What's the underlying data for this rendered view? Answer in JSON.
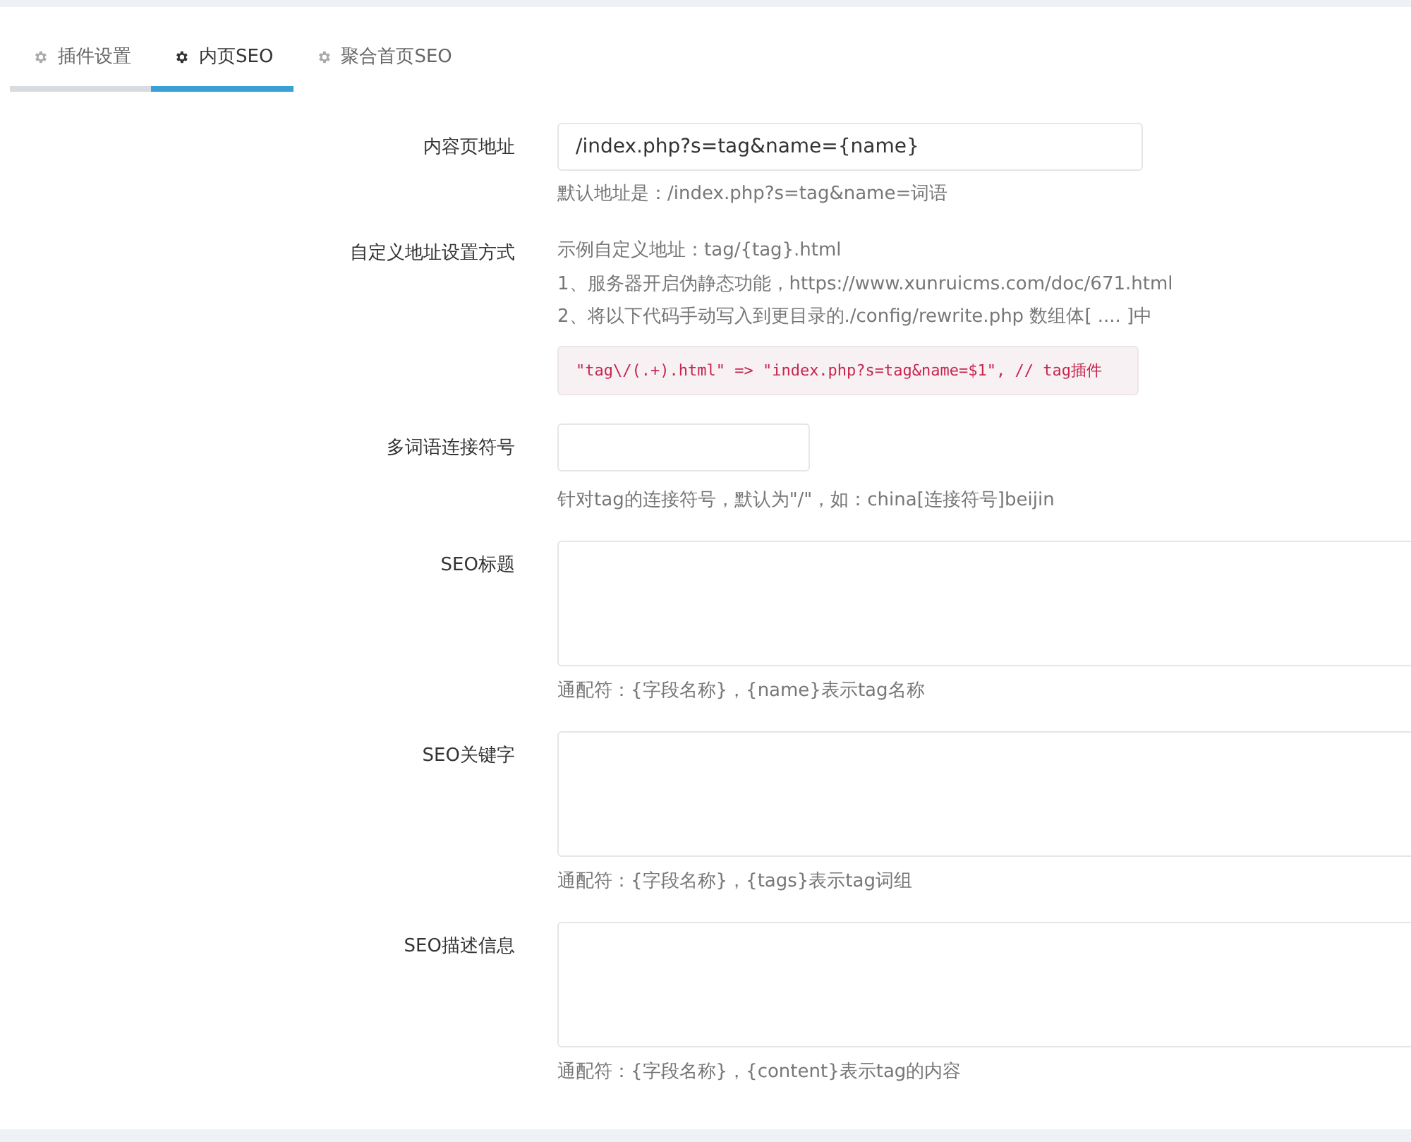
{
  "tabs": [
    {
      "label": "插件设置",
      "selected": false
    },
    {
      "label": "内页SEO",
      "selected": true
    },
    {
      "label": "聚合首页SEO",
      "selected": false
    }
  ],
  "form": [
    {
      "kind": "input",
      "label": "内容页地址",
      "value": "/index.php?s=tag&name={name}",
      "help": "默认地址是：/index.php?s=tag&name=词语"
    },
    {
      "kind": "info",
      "label": "自定义地址设置方式",
      "lines": [
        "示例自定义地址：tag/{tag}.html",
        "1、服务器开启伪静态功能，https://www.xunruicms.com/doc/671.html",
        "2、将以下代码手动写入到更目录的./config/rewrite.php 数组体[ .... ]中"
      ],
      "code": "\"tag\\/(.+).html\" => \"index.php?s=tag&name=$1\", // tag插件"
    },
    {
      "kind": "short",
      "label": "多词语连接符号",
      "help": "针对tag的连接符号，默认为\"/\"，如：china[连接符号]beijin"
    },
    {
      "kind": "textarea",
      "label": "SEO标题",
      "help": "通配符：{字段名称}，{name}表示tag名称"
    },
    {
      "kind": "textarea",
      "label": "SEO关键字",
      "help": "通配符：{字段名称}，{tags}表示tag词组"
    },
    {
      "kind": "textarea",
      "label": "SEO描述信息",
      "help": "通配符：{字段名称}，{content}表示tag的内容"
    }
  ]
}
